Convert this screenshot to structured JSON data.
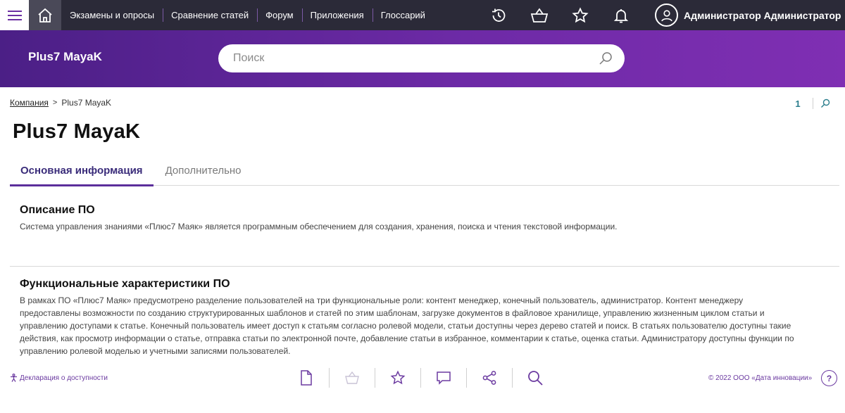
{
  "header": {
    "nav_items": [
      {
        "label": "Экзамены и опросы"
      },
      {
        "label": "Сравнение статей"
      },
      {
        "label": "Форум"
      },
      {
        "label": "Приложения"
      },
      {
        "label": "Глоссарий"
      }
    ],
    "icons": [
      "menu-icon",
      "home-icon",
      "history-icon",
      "basket-icon",
      "star-icon",
      "bell-icon",
      "user-icon",
      "chevron-down-icon"
    ],
    "user_name": "Администратор Администратор"
  },
  "hero": {
    "brand": "Plus7 MayaK",
    "search_placeholder": "Поиск"
  },
  "breadcrumb": {
    "parent": "Компания",
    "current": "Plus7 MayaK"
  },
  "tools": {
    "count": "1"
  },
  "page": {
    "title": "Plus7 MayaK"
  },
  "tabs": [
    {
      "label": "Основная информация",
      "active": true
    },
    {
      "label": "Дополнительно",
      "active": false
    }
  ],
  "sections": [
    {
      "title": "Описание ПО",
      "text": "Система управления знаниями «Плюс7 Маяк» является программным обеспечением для создания, хранения, поиска и чтения текстовой информации."
    },
    {
      "title": "Функциональные характеристики ПО",
      "lines": [
        "В рамках ПО «Плюс7 Маяк» предусмотрено разделение пользователей на три функциональные роли: контент менеджер, конечный пользователь, администратор. Контент менеджеру",
        "предоставлены возможности по созданию структурированных шаблонов и статей по этим шаблонам, загрузке документов в файловое хранилище, управлению жизненным циклом статьи и",
        "управлению доступами к статье. Конечный пользователь имеет доступ к статьям согласно ролевой модели, статьи доступны через дерево статей и поиск. В статьях пользователю доступны такие",
        "действия, как просмотр информации о статье, отправка статьи по электронной почте, добавление статьи в избранное, комментарии к статье, оценка статьи. Администратору доступны функции по",
        "управлению ролевой моделью и учетными записями пользователей."
      ]
    }
  ],
  "footer": {
    "accessibility": "Декларация о доступности",
    "copyright": "© 2022 ООО «Дата инновации»",
    "help": "?",
    "actions": [
      "document-icon",
      "basket-icon",
      "star-icon",
      "comment-icon",
      "share-icon",
      "search-icon"
    ]
  },
  "colors": {
    "topbar": "#2b2a38",
    "hero_start": "#4b1f86",
    "hero_end": "#7f2fb3",
    "accent": "#5b2f9b",
    "link_purple": "#6b3aa0",
    "teal": "#2a7d8c"
  }
}
